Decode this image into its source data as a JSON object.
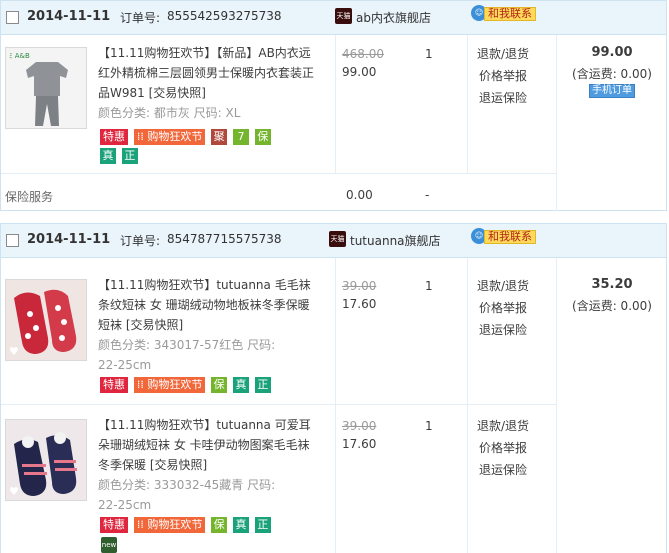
{
  "colors": {
    "header_bg": "#eaf4fb",
    "border": "#cde3f1",
    "tag_red": "#e0263e",
    "tag_orange": "#f2673a",
    "contact_yellow": "#ffd95a",
    "mobile_blue": "#4e9be0"
  },
  "orders": [
    {
      "date": "2014-11-11",
      "order_no_label": "订单号:",
      "order_no": "855542593275738",
      "shop_icon": "tmall-icon",
      "shop_icon_text": "天猫",
      "shop_name": "ab内衣旗舰店",
      "contact_label": "和我联系",
      "items": [
        {
          "thumb_logo": "ﾐ A&B",
          "title": "【11.11购物狂欢节】【新品】AB内衣远红外精梳棉三层圆领男士保暖内衣套装正品W981 [交易快照]",
          "sku": "颜色分类: 都市灰 尺码: XL",
          "tags": [
            "特惠",
            "购物狂欢节",
            "聚",
            "7",
            "保",
            "真",
            "正"
          ],
          "original_price": "468.00",
          "price": "99.00",
          "qty": "1",
          "ops": [
            "退款/退货",
            "价格举报",
            "退运保险"
          ]
        }
      ],
      "total": "99.00",
      "shipping": "(含运费: 0.00)",
      "mobile_badge": "手机订单",
      "service_label": "保险服务",
      "service_value": "0.00",
      "service_dash": "-"
    },
    {
      "date": "2014-11-11",
      "order_no_label": "订单号:",
      "order_no": "854787715575738",
      "shop_icon": "tmall-icon",
      "shop_icon_text": "天猫",
      "shop_name": "tutuanna旗舰店",
      "contact_label": "和我联系",
      "items": [
        {
          "title": "【11.11购物狂欢节】tutuanna 毛毛袜条纹短袜 女 珊瑚绒动物地板袜冬季保暖短袜 [交易快照]",
          "sku": "颜色分类: 343017-57红色 尺码: 22-25cm",
          "tags": [
            "特惠",
            "购物狂欢节",
            "保",
            "真",
            "正"
          ],
          "original_price": "39.00",
          "price": "17.60",
          "qty": "1",
          "ops": [
            "退款/退货",
            "价格举报",
            "退运保险"
          ]
        },
        {
          "title": "【11.11购物狂欢节】tutuanna 可爱耳朵珊瑚绒短袜 女 卡哇伊动物图案毛毛袜冬季保暖 [交易快照]",
          "sku": "颜色分类: 333032-45藏青 尺码: 22-25cm",
          "tags": [
            "特惠",
            "购物狂欢节",
            "保",
            "真",
            "正"
          ],
          "new_icon_text": "new",
          "original_price": "39.00",
          "price": "17.60",
          "qty": "1",
          "ops": [
            "退款/退货",
            "价格举报",
            "退运保险"
          ]
        }
      ],
      "total": "35.20",
      "shipping": "(含运费: 0.00)"
    }
  ]
}
